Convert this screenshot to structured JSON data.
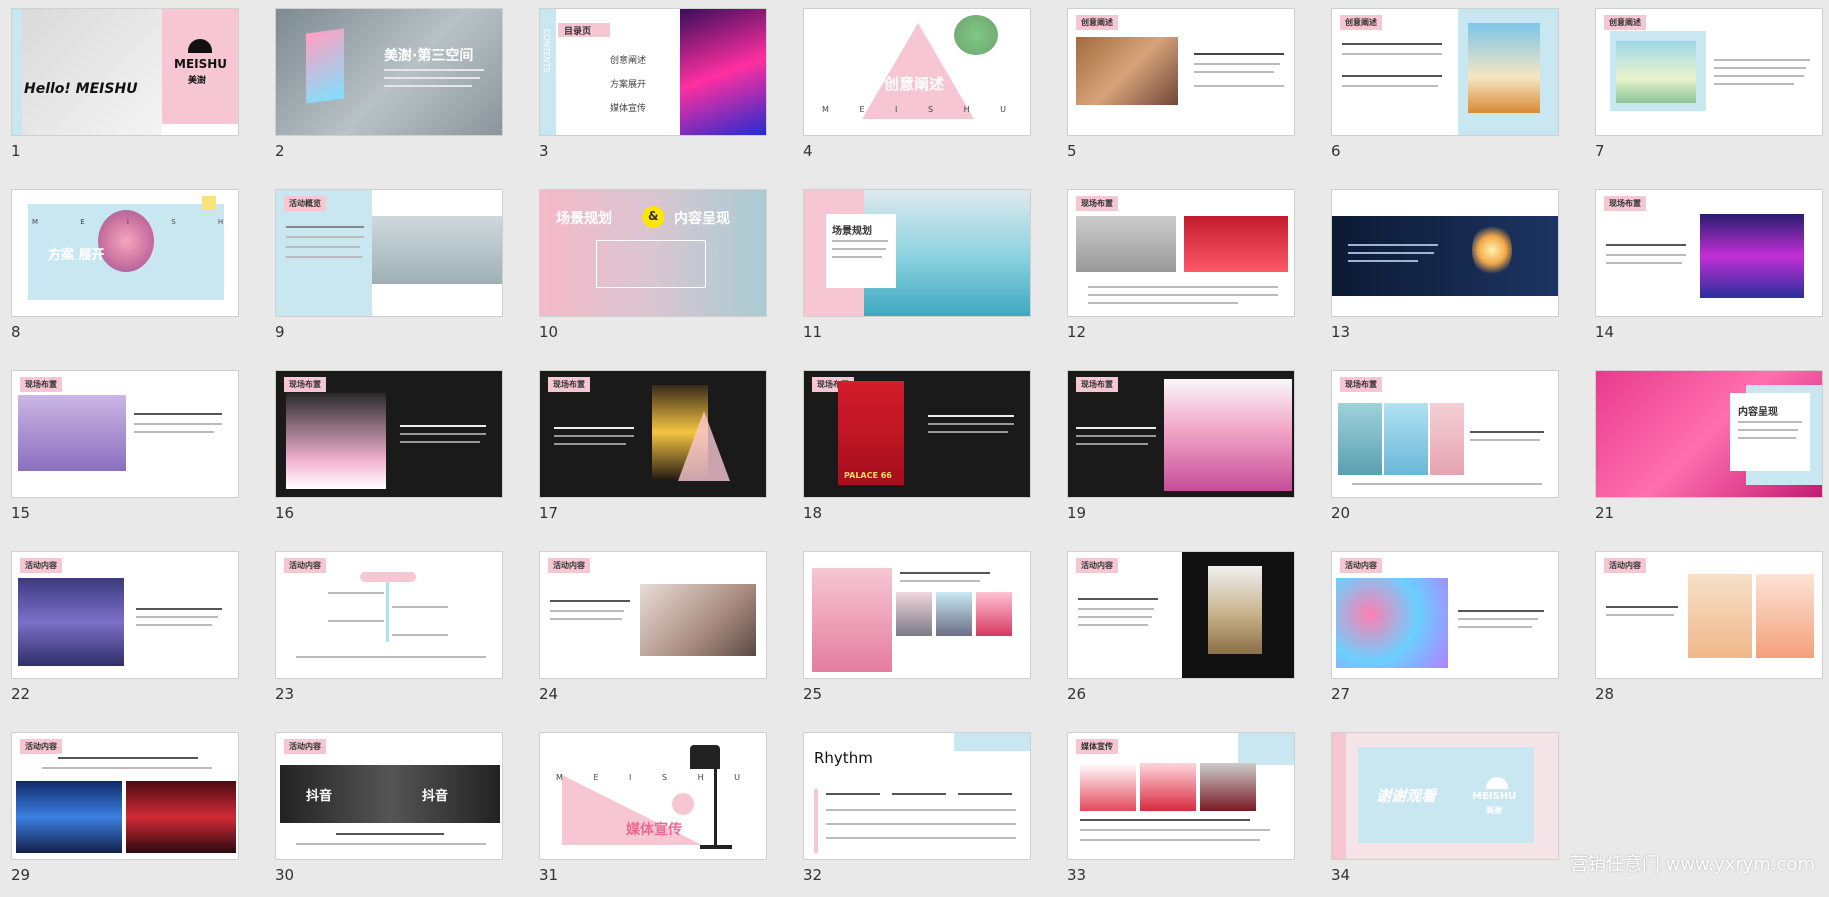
{
  "watermark": "营销任意门 www.yxrym.com",
  "colors": {
    "pink": "#f6c7d2",
    "blue": "#c9e7f1",
    "dark": "#1a1a1a",
    "accent": "#e94d86"
  },
  "slides": [
    {
      "num": "1",
      "title": "Hello! MEISHU",
      "brand": "MEISHU",
      "brand_cn": "美澍"
    },
    {
      "num": "2",
      "title": "美澍·第三空间"
    },
    {
      "num": "3",
      "title": "目录页",
      "items": [
        "创意阐述",
        "方案展开",
        "媒体宣传"
      ],
      "side": "CONTENTS"
    },
    {
      "num": "4",
      "title": "创意阐述",
      "letters": "M E I S H U"
    },
    {
      "num": "5",
      "title": "创意阐述"
    },
    {
      "num": "6",
      "title": "创意阐述"
    },
    {
      "num": "7",
      "title": "创意阐述"
    },
    {
      "num": "8",
      "title": "方案 展开",
      "letters": "M E I S H U"
    },
    {
      "num": "9",
      "title": "活动概览"
    },
    {
      "num": "10",
      "title": "场景规划",
      "title2": "内容呈现",
      "amp": "&"
    },
    {
      "num": "11",
      "title": "场景规划"
    },
    {
      "num": "12",
      "title": "现场布置"
    },
    {
      "num": "13",
      "title": ""
    },
    {
      "num": "14",
      "title": "现场布置"
    },
    {
      "num": "15",
      "title": "现场布置"
    },
    {
      "num": "16",
      "title": "现场布置"
    },
    {
      "num": "17",
      "title": "现场布置"
    },
    {
      "num": "18",
      "title": "现场布置",
      "sign": "PALACE 66"
    },
    {
      "num": "19",
      "title": "现场布置"
    },
    {
      "num": "20",
      "title": "现场布置"
    },
    {
      "num": "21",
      "title": "内容呈现"
    },
    {
      "num": "22",
      "title": "活动内容"
    },
    {
      "num": "23",
      "title": "活动内容"
    },
    {
      "num": "24",
      "title": "活动内容"
    },
    {
      "num": "25",
      "title": ""
    },
    {
      "num": "26",
      "title": "活动内容"
    },
    {
      "num": "27",
      "title": "活动内容"
    },
    {
      "num": "28",
      "title": "活动内容"
    },
    {
      "num": "29",
      "title": "活动内容"
    },
    {
      "num": "30",
      "title": "活动内容",
      "logo": "抖音"
    },
    {
      "num": "31",
      "title": "媒体宣传",
      "letters": "M E I S H U"
    },
    {
      "num": "32",
      "title": "Rhythm"
    },
    {
      "num": "33",
      "title": "媒体宣传"
    },
    {
      "num": "34",
      "title": "谢谢观看",
      "brand": "MEISHU",
      "brand_cn": "美澍"
    }
  ]
}
